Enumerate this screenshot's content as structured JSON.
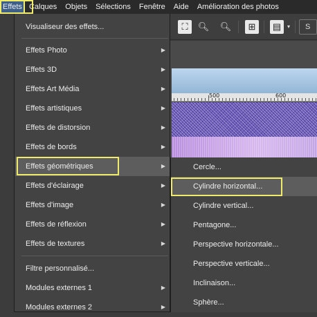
{
  "menubar": {
    "items": [
      {
        "label": "Effets",
        "active": true
      },
      {
        "label": "Calques"
      },
      {
        "label": "Objets"
      },
      {
        "label": "Sélections"
      },
      {
        "label": "Fenêtre"
      },
      {
        "label": "Aide"
      },
      {
        "label": "Amélioration des photos"
      }
    ]
  },
  "toolbar": {
    "s_label": "S",
    "ruler_labels": [
      "500",
      "600"
    ]
  },
  "menu": {
    "items": [
      {
        "label": "Visualiseur des effets...",
        "submenu": false
      },
      {
        "label": "Effets Photo",
        "submenu": true
      },
      {
        "label": "Effets 3D",
        "submenu": true
      },
      {
        "label": "Effets Art Média",
        "submenu": true
      },
      {
        "label": "Effets artistiques",
        "submenu": true
      },
      {
        "label": "Effets de distorsion",
        "submenu": true
      },
      {
        "label": "Effets de bords",
        "submenu": true
      },
      {
        "label": "Effets géométriques",
        "submenu": true,
        "highlighted": true
      },
      {
        "label": "Effets d'éclairage",
        "submenu": true
      },
      {
        "label": "Effets d'image",
        "submenu": true
      },
      {
        "label": "Effets de réflexion",
        "submenu": true
      },
      {
        "label": "Effets de textures",
        "submenu": true
      },
      {
        "label": "Filtre personnalisé...",
        "submenu": false
      },
      {
        "label": "Modules externes 1",
        "submenu": true
      },
      {
        "label": "Modules externes 2",
        "submenu": true
      }
    ]
  },
  "submenu": {
    "items": [
      {
        "label": "Cercle..."
      },
      {
        "label": "Cylindre horizontal...",
        "highlighted": true
      },
      {
        "label": "Cylindre vertical..."
      },
      {
        "label": "Pentagone..."
      },
      {
        "label": "Perspective horizontale..."
      },
      {
        "label": "Perspective verticale..."
      },
      {
        "label": "Inclinaison..."
      },
      {
        "label": "Sphère..."
      }
    ]
  },
  "colors": {
    "highlight_outline": "#f0ec6a",
    "menu_bg": "#434343",
    "menu_hover": "#5d5d5d"
  }
}
